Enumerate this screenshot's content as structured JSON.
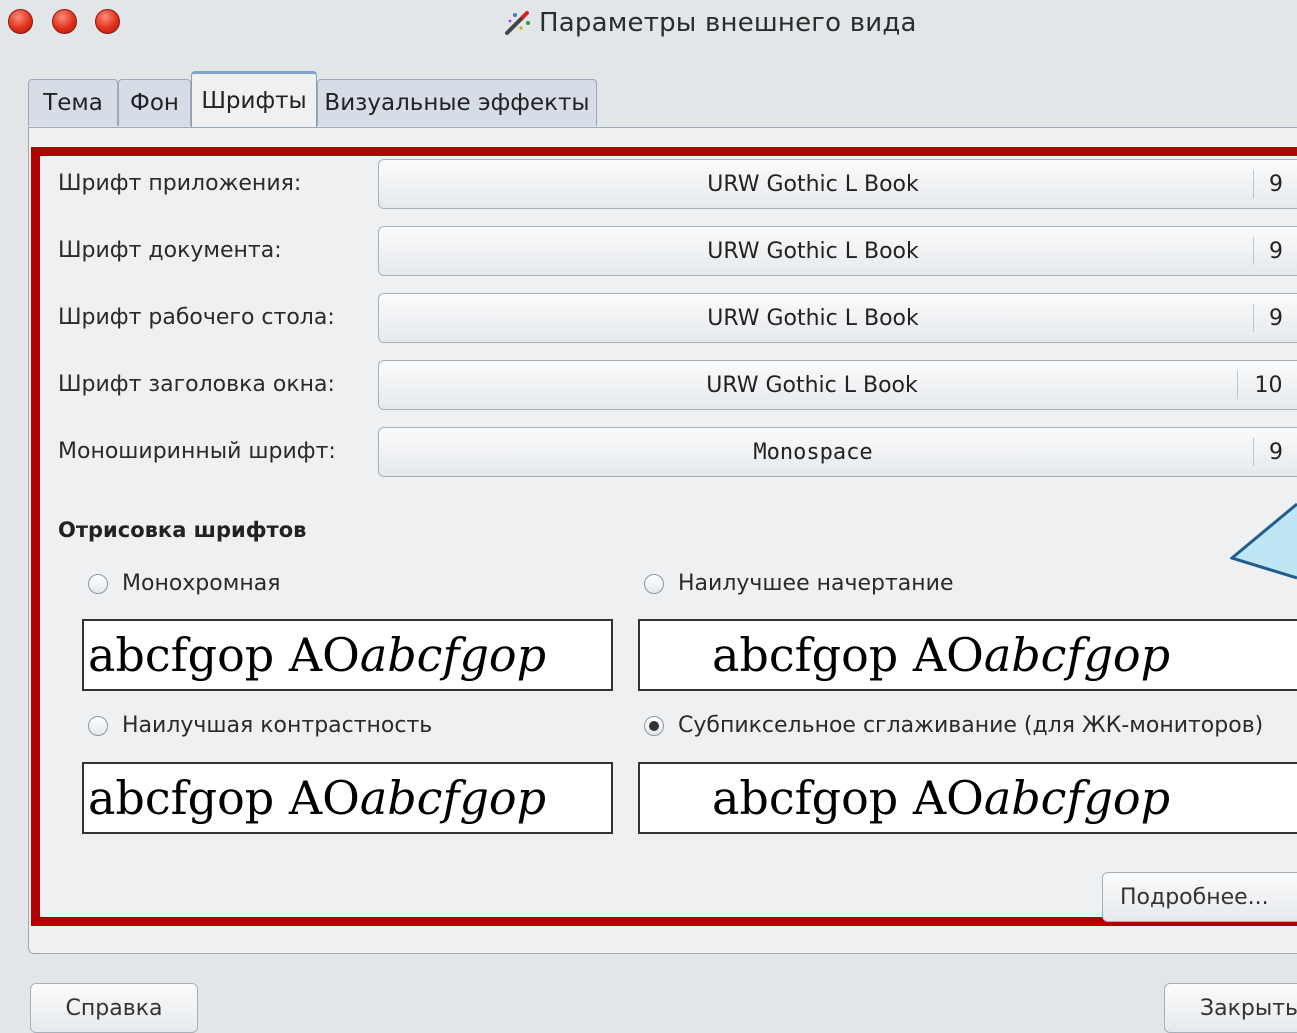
{
  "window": {
    "title": "Параметры внешнего вида",
    "title_icon": "appearance-wand-icon",
    "controls": [
      "close-icon",
      "minimize-icon",
      "maximize-icon"
    ]
  },
  "tabs": [
    {
      "label": "Тема",
      "active": false
    },
    {
      "label": "Фон",
      "active": false
    },
    {
      "label": "Шрифты",
      "active": true
    },
    {
      "label": "Визуальные эффекты",
      "active": false
    }
  ],
  "fonts": [
    {
      "label": "Шрифт приложения:",
      "font": "URW Gothic L Book",
      "size": "9"
    },
    {
      "label": "Шрифт документа:",
      "font": "URW Gothic L Book",
      "size": "9"
    },
    {
      "label": "Шрифт рабочего стола:",
      "font": "URW Gothic L Book",
      "size": "9"
    },
    {
      "label": "Шрифт заголовка окна:",
      "font": "URW Gothic L Book",
      "size": "10"
    },
    {
      "label": "Моноширинный шрифт:",
      "font": "Monospace",
      "size": "9"
    }
  ],
  "rendering": {
    "title": "Отрисовка шрифтов",
    "options": [
      {
        "label": "Монохромная",
        "checked": false
      },
      {
        "label": "Наилучшее начертание",
        "checked": false
      },
      {
        "label": "Наилучшая контрастность",
        "checked": false
      },
      {
        "label": "Субпиксельное сглаживание (для ЖК-мониторов)",
        "checked": true
      }
    ],
    "sample_regular": "abcfgop AO ",
    "sample_italic": "abcfgop"
  },
  "buttons": {
    "details": "Подробнее...",
    "help": "Справка",
    "close": "Закрыть"
  },
  "colors": {
    "highlight_border": "#b00000",
    "callout_fill": "#bfe6f5",
    "callout_stroke": "#1f5d8f"
  }
}
